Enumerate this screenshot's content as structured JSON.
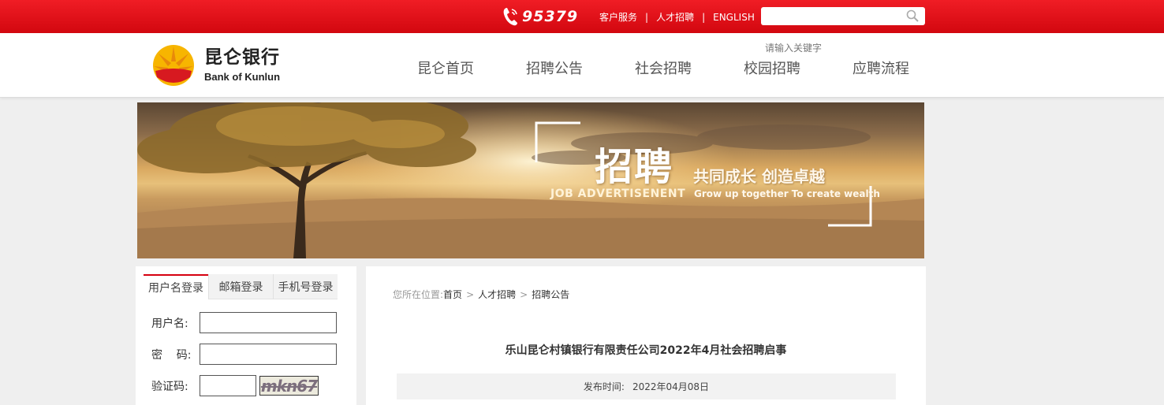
{
  "topbar": {
    "hotline": "95379",
    "links": [
      "客户服务",
      "人才招聘",
      "ENGLISH"
    ],
    "separator": "|"
  },
  "header": {
    "logo_cn": "昆仑银行",
    "logo_en": "Bank of Kunlun",
    "search_placeholder": "请输入关键字",
    "nav": [
      "昆仑首页",
      "招聘公告",
      "社会招聘",
      "校园招聘",
      "应聘流程"
    ]
  },
  "banner": {
    "title": "招聘",
    "slogan": "共同成长  创造卓越",
    "en_left": "JOB   ADVERTISENENT",
    "en_right": "Grow up together To create wealth"
  },
  "login": {
    "tabs": [
      "用户名登录",
      "邮箱登录",
      "手机号登录"
    ],
    "active_tab": 0,
    "username_label": "用户名:",
    "password_label": "密    码:",
    "captcha_label": "验证码:",
    "captcha_text": "mkn67"
  },
  "content": {
    "breadcrumb": {
      "prefix": "您所在位置:",
      "items": [
        "首页",
        "人才招聘",
        "招聘公告"
      ],
      "sep": ">"
    },
    "title": "乐山昆仑村镇银行有限责任公司2022年4月社会招聘启事",
    "publish_label": "发布时间:",
    "publish_date": "2022年04月08日"
  },
  "colors": {
    "brand_red": "#d6000f",
    "logo_yellow": "#f7b500",
    "logo_red": "#d71920"
  }
}
